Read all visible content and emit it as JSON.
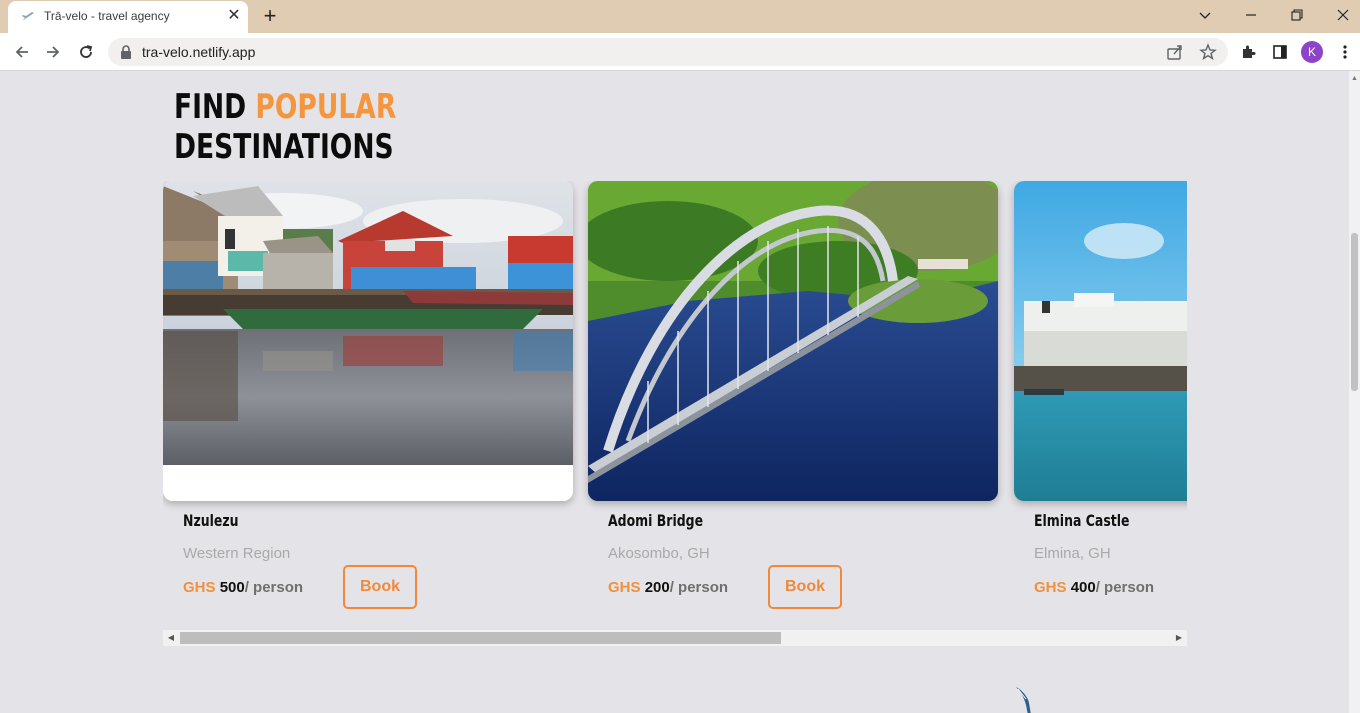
{
  "browser": {
    "tab_title": "Trā-velo - travel agency",
    "url": "tra-velo.netlify.app",
    "avatar_letter": "K"
  },
  "page": {
    "heading_part1": "FIND",
    "heading_accent": "POPULAR",
    "heading_part2": "DESTINATIONS",
    "currency": "GHS",
    "per_label": "/ person",
    "book_label": "Book"
  },
  "destinations": [
    {
      "name": "Nzulezu",
      "region": "Western Region",
      "price": "500"
    },
    {
      "name": "Adomi Bridge",
      "region": "Akosombo, GH",
      "price": "200"
    },
    {
      "name": "Elmina Castle",
      "region": "Elmina, GH",
      "price": "400"
    }
  ],
  "colors": {
    "accent": "#f5963f",
    "tabbar": "#dfccb3",
    "page_bg": "#e4e3e7"
  },
  "scroll": {
    "horizontal_position": 0.0
  }
}
